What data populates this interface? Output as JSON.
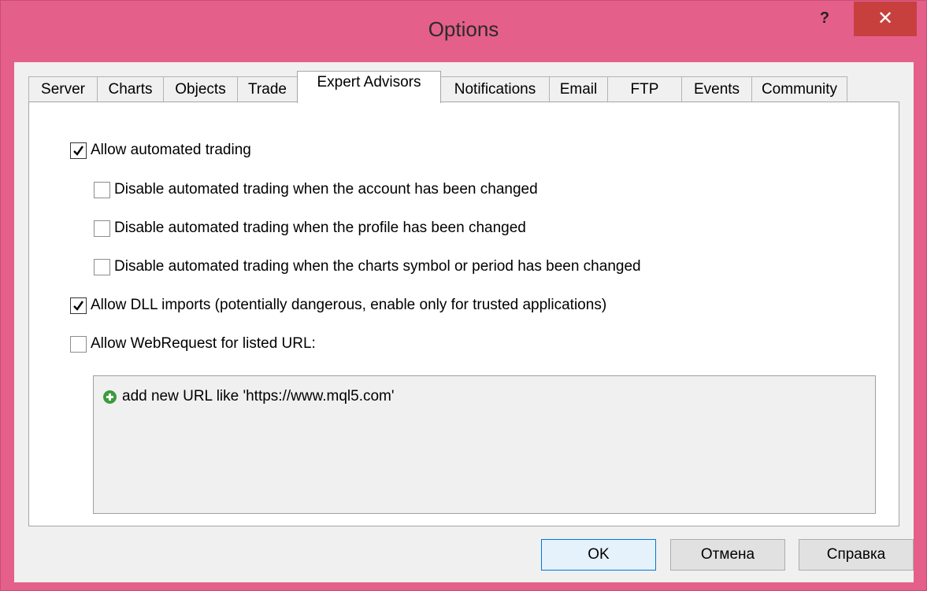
{
  "window": {
    "title": "Options",
    "help_label": "?",
    "close_label": "✕"
  },
  "tabs": [
    {
      "label": "Server"
    },
    {
      "label": "Charts"
    },
    {
      "label": "Objects"
    },
    {
      "label": "Trade"
    },
    {
      "label": "Expert Advisors",
      "active": true
    },
    {
      "label": "Notifications"
    },
    {
      "label": "Email"
    },
    {
      "label": "FTP"
    },
    {
      "label": "Events"
    },
    {
      "label": "Community"
    }
  ],
  "options": {
    "allow_automated_trading": {
      "label": "Allow automated trading",
      "checked": true
    },
    "disable_on_account_change": {
      "label": "Disable automated trading when the account has been changed",
      "checked": false
    },
    "disable_on_profile_change": {
      "label": "Disable automated trading when the profile has been changed",
      "checked": false
    },
    "disable_on_chart_change": {
      "label": "Disable automated trading when the charts symbol or period has been changed",
      "checked": false
    },
    "allow_dll_imports": {
      "label": "Allow DLL imports (potentially dangerous, enable only for trusted applications)",
      "checked": true
    },
    "allow_webrequest": {
      "label": "Allow WebRequest for listed URL:",
      "checked": false
    }
  },
  "url_list": {
    "add_item": "add new URL like 'https://www.mql5.com'"
  },
  "buttons": {
    "ok": "OK",
    "cancel": "Отмена",
    "help": "Справка"
  },
  "colors": {
    "title_bar": "#e55f8b",
    "close_button": "#c8403e",
    "add_icon": "#3c9b3c"
  },
  "icons": {
    "checkbox_checked": "checkmark-icon",
    "add_url": "plus-circle-icon",
    "close": "close-icon",
    "help": "help-icon"
  }
}
